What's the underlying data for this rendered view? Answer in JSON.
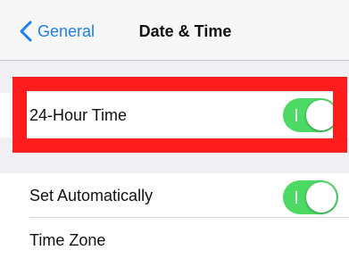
{
  "navbar": {
    "back_label": "General",
    "title": "Date & Time",
    "accent": "#1b7ff7"
  },
  "settings": {
    "hour_time": {
      "label": "24-Hour Time",
      "enabled": true
    },
    "set_automatically": {
      "label": "Set Automatically",
      "enabled": true
    },
    "time_zone": {
      "label": "Time Zone"
    }
  },
  "colors": {
    "toggle_on": "#4cd964",
    "highlight": "#ff1c1c",
    "background": "#efeff4"
  }
}
